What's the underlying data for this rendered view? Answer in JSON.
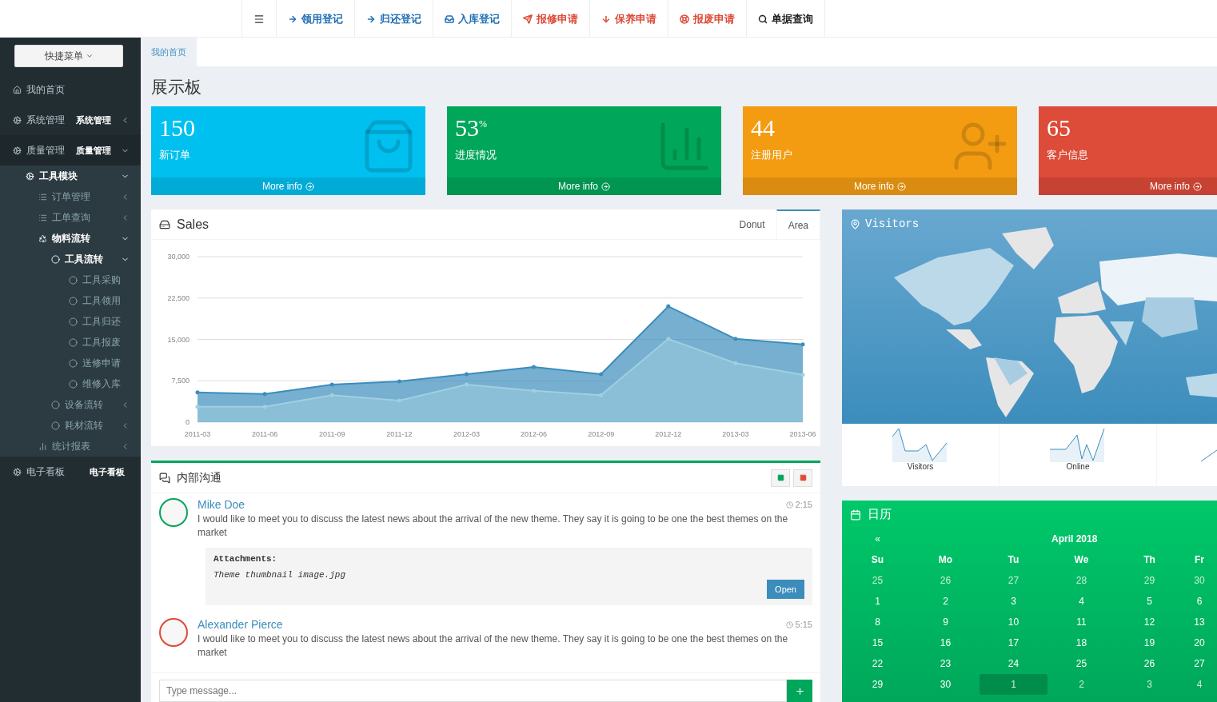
{
  "topnav": [
    {
      "label": "领用登记",
      "color": "#1f6fb5"
    },
    {
      "label": "归还登记",
      "color": "#1f6fb5"
    },
    {
      "label": "入库登记",
      "color": "#1f6fb5"
    },
    {
      "label": "报修申请",
      "color": "#dd4b39"
    },
    {
      "label": "保养申请",
      "color": "#dd4b39"
    },
    {
      "label": "报废申请",
      "color": "#dd4b39"
    },
    {
      "label": "单据查询",
      "color": "#222222"
    }
  ],
  "sidebar": {
    "quick_menu": "快捷菜单",
    "items": [
      {
        "label": "我的首页"
      },
      {
        "label": "系统管理",
        "badge": "系统管理",
        "expanded": false
      },
      {
        "label": "质量管理",
        "badge": "质量管理",
        "expanded": true,
        "children": [
          {
            "label": "工具模块",
            "expanded": true,
            "children": [
              {
                "label": "订单管理",
                "expanded": false
              },
              {
                "label": "工单查询",
                "expanded": false
              },
              {
                "label": "物料流转",
                "expanded": true,
                "children": [
                  {
                    "label": "工具流转",
                    "expanded": true,
                    "children": [
                      {
                        "label": "工具采购"
                      },
                      {
                        "label": "工具领用"
                      },
                      {
                        "label": "工具归还"
                      },
                      {
                        "label": "工具报废"
                      },
                      {
                        "label": "送修申请"
                      },
                      {
                        "label": "维修入库"
                      }
                    ]
                  },
                  {
                    "label": "设备流转",
                    "expanded": false
                  },
                  {
                    "label": "耗材流转",
                    "expanded": false
                  }
                ]
              },
              {
                "label": "统计报表",
                "expanded": false
              }
            ]
          }
        ]
      },
      {
        "label": "电子看板",
        "badge": "电子看板"
      }
    ]
  },
  "breadcrumb": "我的首页",
  "page_title": "展示板",
  "stats": [
    {
      "value": "150",
      "label": "新订单",
      "link": "More info",
      "color": "#00c0ef"
    },
    {
      "value": "53$^{%}$",
      "label": "进度情况",
      "link": "More info",
      "color": "#00a65a"
    },
    {
      "value": "44",
      "label": "注册用户",
      "link": "More info",
      "color": "#f39c12"
    },
    {
      "value": "65",
      "label": "客户信息",
      "link": "More info",
      "color": "#dd4b39"
    }
  ],
  "sales": {
    "title": "Sales",
    "tabs": [
      {
        "label": "Donut",
        "selected": false
      },
      {
        "label": "Area",
        "selected": true
      }
    ],
    "chart_data": {
      "type": "area",
      "categories": [
        "2011-03",
        "2011-06",
        "2011-09",
        "2011-12",
        "2012-03",
        "2012-06",
        "2012-09",
        "2012-12",
        "2013-03",
        "2013-06"
      ],
      "ylim": [
        0,
        30000
      ],
      "grid": true,
      "yticks": [
        {
          "value": 0,
          "label": "0"
        },
        {
          "value": 7500,
          "label": "7,500"
        },
        {
          "value": 15000,
          "label": "15,000"
        },
        {
          "value": 22500,
          "label": "22,500"
        },
        {
          "value": 30000,
          "label": "30,000"
        }
      ],
      "series": [
        {
          "color": "#3c8dbc",
          "values": [
            5400,
            5100,
            6800,
            7400,
            8700,
            10000,
            8700,
            21000,
            15100,
            14100
          ]
        },
        {
          "color": "#a0d0e0",
          "values": [
            2800,
            2800,
            4900,
            3900,
            6800,
            5700,
            4900,
            15100,
            10700,
            8600
          ]
        }
      ]
    }
  },
  "chat": {
    "title": "内部沟通",
    "messages": [
      {
        "name": "Mike Doe",
        "time": "2:15",
        "color": "#00a65a",
        "text": "I would like to meet you to discuss the latest news about the arrival of the new theme. They say it is going to be one the best themes on the market",
        "attachment": {
          "heading": "Attachments:",
          "file": "Theme thumbnail image.jpg",
          "button": "Open"
        }
      },
      {
        "name": "Alexander Pierce",
        "time": "5:15",
        "color": "#dd4b39",
        "text": "I would like to meet you to discuss the latest news about the arrival of the new theme. They say it is going to be one the best themes on the market"
      }
    ],
    "placeholder": "Type message..."
  },
  "visitors": {
    "title": "Visitors",
    "sparklines": [
      "Visitors",
      "Online"
    ]
  },
  "calendar": {
    "title": "日历",
    "prev": "«",
    "month": "April 2018",
    "weekdays": [
      "Su",
      "Mo",
      "Tu",
      "We",
      "Th",
      "Fr"
    ],
    "weeks": [
      [
        {
          "day": "25",
          "muted": true,
          "selected": false
        },
        {
          "day": "26",
          "muted": true,
          "selected": false
        },
        {
          "day": "27",
          "muted": true,
          "selected": false
        },
        {
          "day": "28",
          "muted": true,
          "selected": false
        },
        {
          "day": "29",
          "muted": true,
          "selected": false
        },
        {
          "day": "30",
          "muted": true,
          "selected": false
        }
      ],
      [
        {
          "day": "1",
          "muted": false,
          "selected": false
        },
        {
          "day": "2",
          "muted": false,
          "selected": false
        },
        {
          "day": "3",
          "muted": false,
          "selected": false
        },
        {
          "day": "4",
          "muted": false,
          "selected": false
        },
        {
          "day": "5",
          "muted": false,
          "selected": false
        },
        {
          "day": "6",
          "muted": false,
          "selected": false
        }
      ],
      [
        {
          "day": "8",
          "muted": false,
          "selected": false
        },
        {
          "day": "9",
          "muted": false,
          "selected": false
        },
        {
          "day": "10",
          "muted": false,
          "selected": false
        },
        {
          "day": "11",
          "muted": false,
          "selected": false
        },
        {
          "day": "12",
          "muted": false,
          "selected": false
        },
        {
          "day": "13",
          "muted": false,
          "selected": false
        }
      ],
      [
        {
          "day": "15",
          "muted": false,
          "selected": false
        },
        {
          "day": "16",
          "muted": false,
          "selected": false
        },
        {
          "day": "17",
          "muted": false,
          "selected": false
        },
        {
          "day": "18",
          "muted": false,
          "selected": false
        },
        {
          "day": "19",
          "muted": false,
          "selected": false
        },
        {
          "day": "20",
          "muted": false,
          "selected": false
        }
      ],
      [
        {
          "day": "22",
          "muted": false,
          "selected": false
        },
        {
          "day": "23",
          "muted": false,
          "selected": false
        },
        {
          "day": "24",
          "muted": false,
          "selected": false
        },
        {
          "day": "25",
          "muted": false,
          "selected": false
        },
        {
          "day": "26",
          "muted": false,
          "selected": false
        },
        {
          "day": "27",
          "muted": false,
          "selected": false
        }
      ],
      [
        {
          "day": "29",
          "muted": false,
          "selected": false
        },
        {
          "day": "30",
          "muted": false,
          "selected": false
        },
        {
          "day": "1",
          "muted": true,
          "selected": true
        },
        {
          "day": "2",
          "muted": true,
          "selected": false
        },
        {
          "day": "3",
          "muted": true,
          "selected": false
        },
        {
          "day": "4",
          "muted": true,
          "selected": false
        }
      ]
    ]
  }
}
